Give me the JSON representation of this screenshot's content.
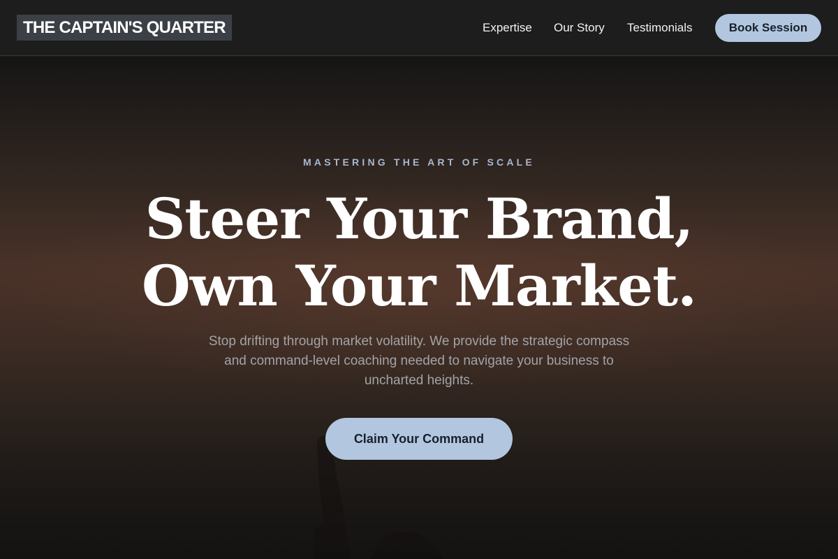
{
  "header": {
    "logo_text": "THE CAPTAIN'S QUARTER",
    "nav": [
      {
        "label": "Expertise"
      },
      {
        "label": "Our Story"
      },
      {
        "label": "Testimonials"
      }
    ],
    "cta_label": "Book Session"
  },
  "hero": {
    "eyebrow": "MASTERING THE ART OF SCALE",
    "headline_line1": "Steer Your Brand,",
    "headline_line2": "Own Your Market.",
    "subtext": "Stop drifting through market volatility. We provide the strategic compass and command-level coaching needed to navigate your business to uncharted heights.",
    "cta_label": "Claim Your Command"
  },
  "colors": {
    "accent": "#b3c6e0",
    "header_bg": "#1d1d1d",
    "logo_bg": "#3b4046",
    "eyebrow": "#a8b8cf",
    "subtext": "#a3a3a6"
  }
}
